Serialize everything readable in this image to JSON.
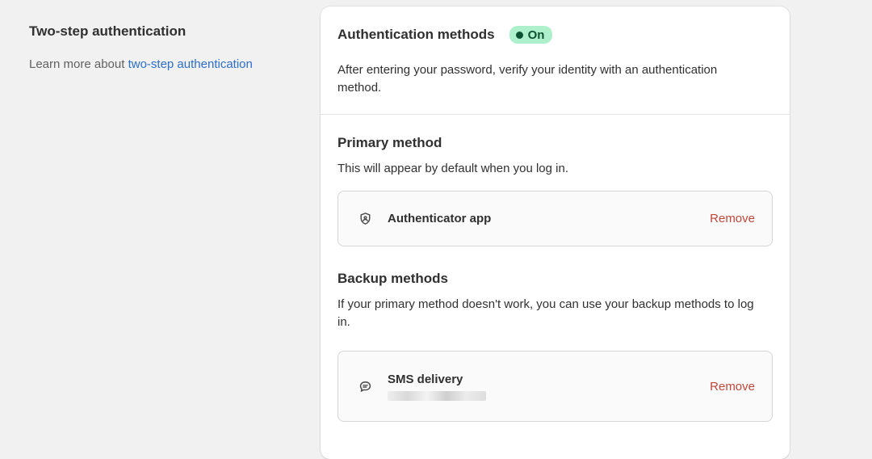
{
  "left": {
    "title": "Two-step authentication",
    "learn_prefix": "Learn more about ",
    "learn_link": "two-step authentication"
  },
  "card": {
    "title": "Authentication methods",
    "status": "On",
    "description": "After entering your password, verify your identity with an authentication method.",
    "primary": {
      "title": "Primary method",
      "description": "This will appear by default when you log in.",
      "method": {
        "icon": "shield-icon",
        "name": "Authenticator app",
        "action": "Remove"
      }
    },
    "backup": {
      "title": "Backup methods",
      "description": "If your primary method doesn't work, you can use your backup methods to log in.",
      "method": {
        "icon": "chat-bubble-icon",
        "name": "SMS delivery",
        "detail": "",
        "action": "Remove"
      }
    }
  },
  "colors": {
    "link": "#2c6ecb",
    "remove": "#c4463a",
    "badge_bg": "#aff0cc",
    "badge_text": "#0c5132"
  }
}
